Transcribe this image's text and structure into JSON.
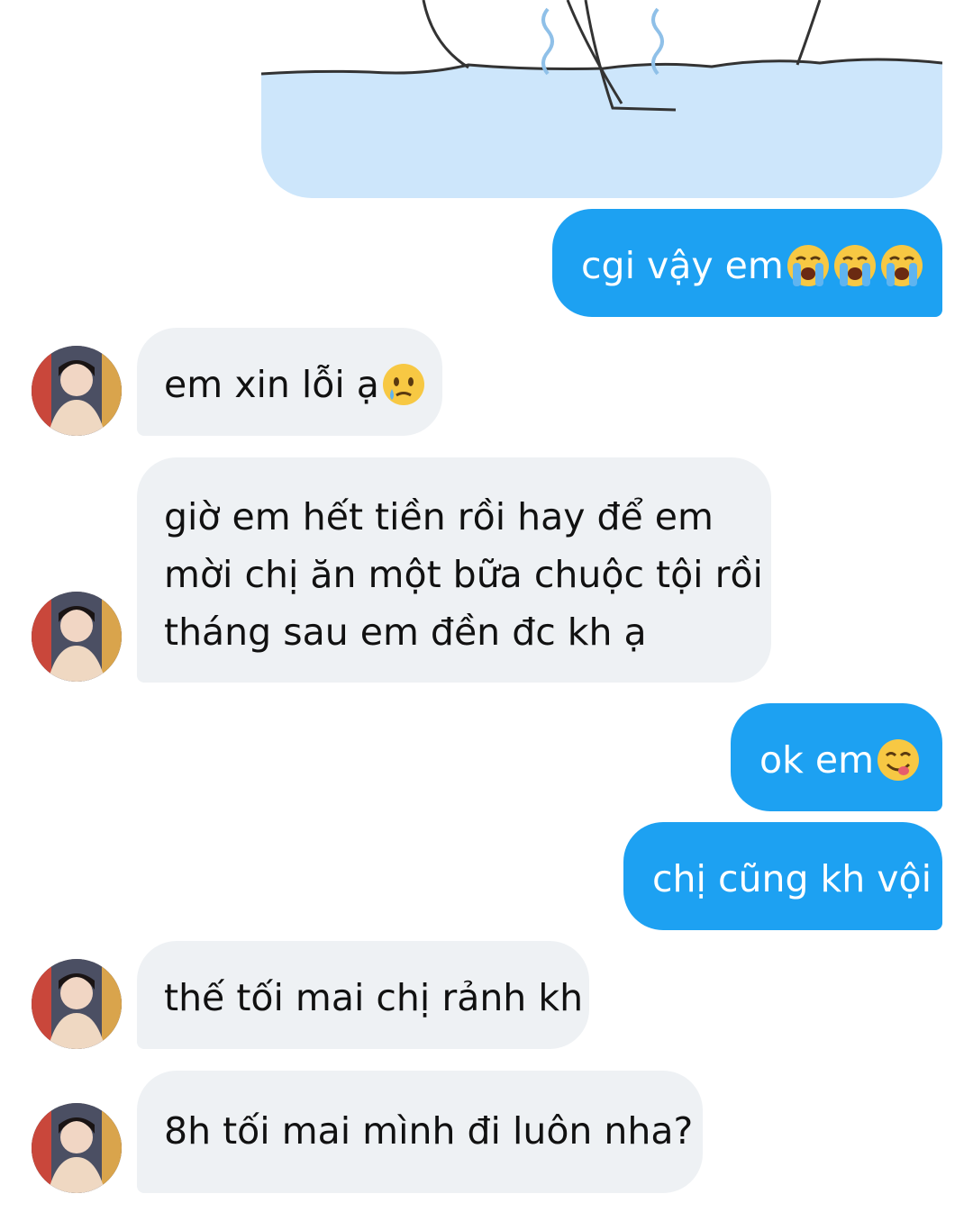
{
  "messages": [
    {
      "id": "m1",
      "direction": "outgoing",
      "type": "sticker",
      "icon": "crying-cat-sticker"
    },
    {
      "id": "m2",
      "direction": "outgoing",
      "text": "cgi vậy em",
      "emoji": [
        "loudly-crying-face",
        "loudly-crying-face",
        "loudly-crying-face"
      ]
    },
    {
      "id": "m3",
      "direction": "incoming",
      "text": "em xin lỗi ạ",
      "emoji": [
        "face-holding-back-tears"
      ]
    },
    {
      "id": "m4",
      "direction": "incoming",
      "lines": [
        "giờ em hết tiền rồi hay để em",
        "mời chị ăn một bữa chuộc tội rồi",
        "tháng sau em đền đc kh ạ"
      ]
    },
    {
      "id": "m5",
      "direction": "outgoing",
      "text": "ok em",
      "emoji": [
        "face-savoring-food"
      ]
    },
    {
      "id": "m6",
      "direction": "outgoing",
      "text": "chị cũng kh vội"
    },
    {
      "id": "m7",
      "direction": "incoming",
      "text": "thế tối mai chị rảnh kh"
    },
    {
      "id": "m8",
      "direction": "incoming",
      "text": "8h tối mai mình đi luôn nha?"
    }
  ],
  "colors": {
    "outgoing_bubble": "#1da1f2",
    "incoming_bubble": "#eef1f4",
    "sticker_water": "#cde6fb"
  }
}
